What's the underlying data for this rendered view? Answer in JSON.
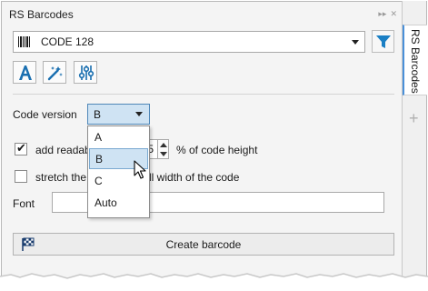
{
  "panel": {
    "title": "RS Barcodes",
    "collapse_glyph": "▸▸",
    "close_glyph": "✕"
  },
  "side_strip": {
    "tab_label": "RS Barcodes",
    "add_glyph": "+"
  },
  "barcode_type": {
    "selected": "CODE 128",
    "icon": "barcode-icon"
  },
  "toolbar": {
    "filter_icon": "filter-icon",
    "buttons": [
      {
        "icon": "text-format-icon"
      },
      {
        "icon": "magic-wand-icon"
      },
      {
        "icon": "sliders-icon"
      }
    ]
  },
  "code_version": {
    "label": "Code version",
    "value": "B",
    "options": [
      "A",
      "B",
      "C",
      "Auto"
    ],
    "highlighted": "B"
  },
  "readable_text": {
    "checked": true,
    "label_visible": "add readab",
    "spin_value_visible": "5",
    "suffix": "% of code height"
  },
  "stretch": {
    "checked": false,
    "label_left": "stretch the",
    "label_right": "ll width of the code"
  },
  "font": {
    "label": "Font",
    "value": ""
  },
  "create_button": {
    "label": "Create barcode",
    "icon": "checkered-flag-icon"
  },
  "colors": {
    "accent": "#1a7fc4",
    "selection": "#cfe3f3",
    "pane_bg": "#f4f4f4"
  }
}
